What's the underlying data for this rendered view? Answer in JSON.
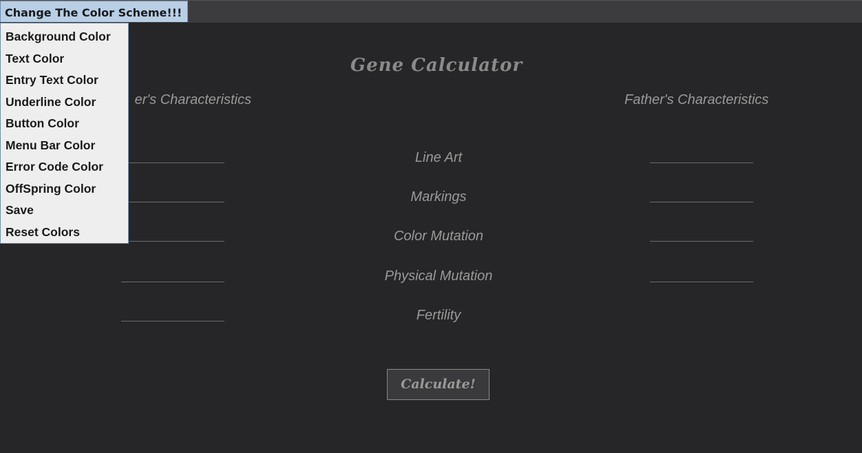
{
  "menu": {
    "title": "Change The Color Scheme!!!",
    "items": [
      {
        "label": "Background Color"
      },
      {
        "label": "Text Color"
      },
      {
        "label": "Entry Text Color"
      },
      {
        "label": "Underline Color"
      },
      {
        "label": "Button Color"
      },
      {
        "label": "Menu Bar Color"
      },
      {
        "label": "Error Code Color"
      },
      {
        "label": "OffSpring Color"
      },
      {
        "label": "Save"
      },
      {
        "label": "Reset Colors"
      }
    ]
  },
  "app": {
    "title": "Gene Calculator"
  },
  "headers": {
    "mother": "er's Characteristics",
    "father": "Father's Characteristics"
  },
  "traits": [
    {
      "label": "Line Art"
    },
    {
      "label": "Markings"
    },
    {
      "label": "Color Mutation"
    },
    {
      "label": "Physical Mutation"
    },
    {
      "label": "Fertility"
    }
  ],
  "mother_entries": [
    "",
    "",
    "",
    "",
    ""
  ],
  "father_entries": [
    "",
    "",
    "",
    ""
  ],
  "calculate_button": {
    "label": "Calculate!"
  },
  "colors": {
    "background": "#262628",
    "menubar": "#3c3c3e",
    "menu_highlight": "#b8cfe5",
    "dropdown_bg": "#eeeeee",
    "text": "#9a9a9a",
    "underline": "#6b6b6b"
  }
}
